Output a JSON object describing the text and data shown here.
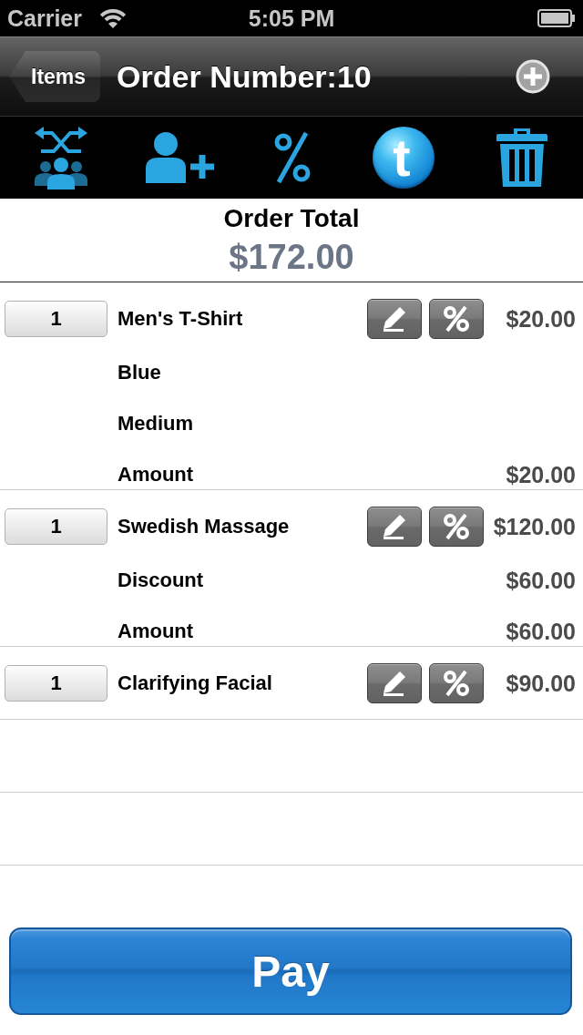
{
  "status_bar": {
    "carrier": "Carrier",
    "time": "5:05 PM"
  },
  "nav_bar": {
    "back_button": "Items",
    "title": "Order Number:10"
  },
  "toolbar": [
    {
      "kind": "shuffle-group"
    },
    {
      "kind": "add-person"
    },
    {
      "kind": "percent"
    },
    {
      "kind": "logo",
      "text": "t"
    },
    {
      "kind": "trash"
    }
  ],
  "order_total": {
    "label": "Order Total",
    "amount": "$172.00"
  },
  "order_items": [
    {
      "quantity": "1",
      "name": "Men's T-Shirt",
      "price": "$20.00",
      "details": [
        {
          "label": "Blue"
        },
        {
          "label": "Medium"
        },
        {
          "label": "Amount",
          "value": "$20.00"
        }
      ]
    },
    {
      "quantity": "1",
      "name": "Swedish Massage",
      "price": "$120.00",
      "details": [
        {
          "label": "Discount",
          "value": "$60.00"
        },
        {
          "label": "Amount",
          "value": "$60.00"
        }
      ]
    },
    {
      "quantity": "1",
      "name": "Clarifying Facial",
      "price": "$90.00"
    }
  ],
  "pay_button": "Pay"
}
